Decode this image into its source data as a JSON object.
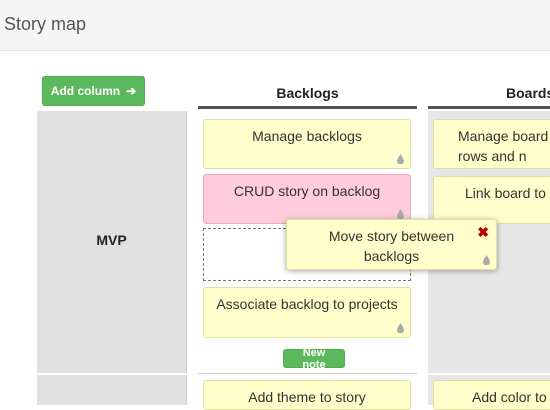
{
  "header": {
    "title": "Story map"
  },
  "toolbar": {
    "add_column_label": "Add column",
    "add_column_arrow": "➔"
  },
  "columns": [
    {
      "label": "Backlogs"
    },
    {
      "label": "Boards"
    }
  ],
  "rows": [
    {
      "label": "MVP"
    },
    {
      "label": ""
    }
  ],
  "notes": {
    "backlogs": [
      {
        "text": "Manage backlogs"
      },
      {
        "text": "CRUD story on backlog"
      },
      {
        "text": "Associate backlog to projects"
      }
    ],
    "backlogs_next": [
      {
        "text": "Add theme to story"
      }
    ],
    "boards": [
      {
        "text": "Manage board rows and n"
      },
      {
        "text": "Link board to"
      }
    ],
    "boards_next": [
      {
        "text": "Add color to"
      }
    ],
    "dragging": {
      "text": "Move story between backlogs",
      "close": "✖"
    }
  },
  "new_note_label": "New note",
  "colors": {
    "note_yellow": "#ffffcc",
    "note_pink": "#ffccdd",
    "green": "#5cb85c",
    "close_red": "#b00000"
  }
}
